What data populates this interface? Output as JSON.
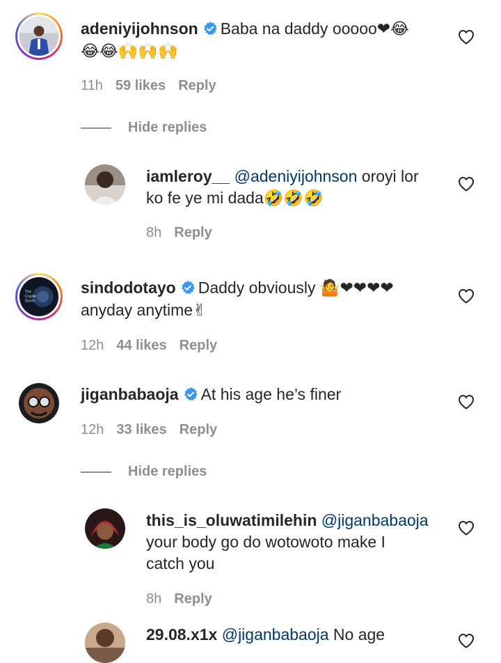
{
  "comments": [
    {
      "username": "adeniyijohnson",
      "verified": true,
      "text": "Baba na daddy ooooo",
      "emoji1": "❤😂",
      "emoji2": "😂😂🙌🙌🙌",
      "time": "11h",
      "likes": "59 likes",
      "reply": "Reply"
    },
    {
      "hide_replies": "Hide replies"
    },
    {
      "username": "iamleroy__",
      "mention": "@adeniyijohnson",
      "text_line1": " oroyi lor",
      "text_line2": "ko fe ye mi dada",
      "emoji": "🤣🤣🤣",
      "time": "8h",
      "reply": "Reply"
    },
    {
      "username": "sindodotayo",
      "verified": true,
      "text": "Daddy obviously",
      "emoji1": "🤷❤❤❤❤",
      "text_line2": "anyday anytime",
      "emoji2": "✌",
      "time": "12h",
      "likes": "44 likes",
      "reply": "Reply"
    },
    {
      "username": "jiganbabaoja",
      "verified": true,
      "text": "At his age he’s finer",
      "time": "12h",
      "likes": "33 likes",
      "reply": "Reply"
    },
    {
      "hide_replies": "Hide replies"
    },
    {
      "username": "this_is_oluwatimilehin",
      "mention": "@jiganbabaoja",
      "text_line2": "your body go do wotowoto make I",
      "text_line3": "catch you",
      "time": "8h",
      "reply": "Reply"
    },
    {
      "username": "29.08.x1x",
      "mention": "@jiganbabaoja",
      "text": " No age"
    }
  ],
  "colors": {
    "verified": "#3897f0",
    "mention": "#00376b",
    "meta": "#8e8e8e"
  }
}
